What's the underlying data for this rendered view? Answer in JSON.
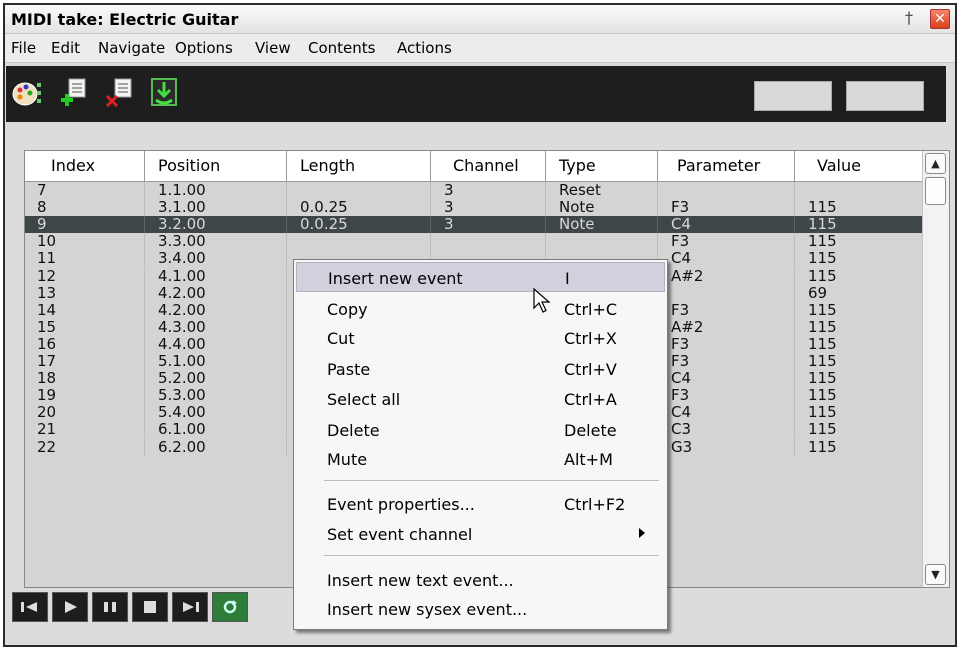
{
  "window": {
    "title": "MIDI take: Electric Guitar",
    "pin_glyph": "†",
    "close_glyph": "✕"
  },
  "menubar": [
    "File",
    "Edit",
    "Navigate",
    "Options",
    "View",
    "Contents",
    "Actions"
  ],
  "toolbar": {
    "buttons": [
      "piano-roll-icon",
      "insert-event-icon",
      "delete-event-icon",
      "import-event-icon"
    ]
  },
  "table": {
    "columns": [
      "Index",
      "Position",
      "Length",
      "Channel",
      "Type",
      "Parameter",
      "Value"
    ],
    "rows": [
      [
        "7",
        "1.1.00",
        "",
        "3",
        "Reset",
        "",
        ""
      ],
      [
        "8",
        "3.1.00",
        "0.0.25",
        "3",
        "Note",
        "F3",
        "115"
      ],
      [
        "9",
        "3.2.00",
        "0.0.25",
        "3",
        "Note",
        "C4",
        "115"
      ],
      [
        "10",
        "3.3.00",
        "",
        "",
        "",
        "F3",
        "115"
      ],
      [
        "11",
        "3.4.00",
        "",
        "",
        "",
        "C4",
        "115"
      ],
      [
        "12",
        "4.1.00",
        "",
        "",
        "",
        "A#2",
        "115"
      ],
      [
        "13",
        "4.2.00",
        "",
        "",
        "",
        "",
        "69"
      ],
      [
        "14",
        "4.2.00",
        "",
        "",
        "",
        "F3",
        "115"
      ],
      [
        "15",
        "4.3.00",
        "",
        "",
        "",
        "A#2",
        "115"
      ],
      [
        "16",
        "4.4.00",
        "",
        "",
        "",
        "F3",
        "115"
      ],
      [
        "17",
        "5.1.00",
        "",
        "",
        "",
        "F3",
        "115"
      ],
      [
        "18",
        "5.2.00",
        "",
        "",
        "",
        "C4",
        "115"
      ],
      [
        "19",
        "5.3.00",
        "",
        "",
        "",
        "F3",
        "115"
      ],
      [
        "20",
        "5.4.00",
        "",
        "",
        "",
        "C4",
        "115"
      ],
      [
        "21",
        "6.1.00",
        "",
        "",
        "",
        "C3",
        "115"
      ],
      [
        "22",
        "6.2.00",
        "",
        "",
        "",
        "G3",
        "115"
      ]
    ],
    "selected_index": "9"
  },
  "context_menu": {
    "items": [
      {
        "label": "Insert new event",
        "shortcut": "I"
      },
      {
        "label": "Copy",
        "shortcut": "Ctrl+C"
      },
      {
        "label": "Cut",
        "shortcut": "Ctrl+X"
      },
      {
        "label": "Paste",
        "shortcut": "Ctrl+V"
      },
      {
        "label": "Select all",
        "shortcut": "Ctrl+A"
      },
      {
        "label": "Delete",
        "shortcut": "Delete"
      },
      {
        "label": "Mute",
        "shortcut": "Alt+M"
      },
      {
        "label": "Event properties...",
        "shortcut": "Ctrl+F2"
      },
      {
        "label": "Set event channel",
        "shortcut": ""
      },
      {
        "label": "Insert new text event...",
        "shortcut": ""
      },
      {
        "label": "Insert new sysex event...",
        "shortcut": ""
      }
    ]
  },
  "transport": [
    "go-to-start-icon",
    "play-icon",
    "pause-icon",
    "stop-icon",
    "go-to-end-icon",
    "repeat-icon"
  ],
  "colors": {
    "selected_row": "#3e4648",
    "menu_highlight": "#d2d0dc",
    "toolbar_bg": "#1e1e1e"
  }
}
